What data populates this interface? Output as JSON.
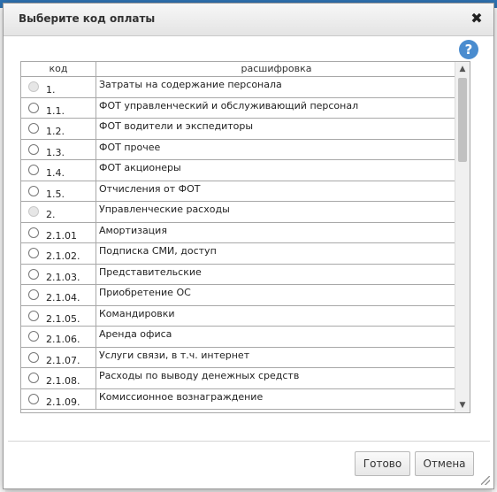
{
  "dialog": {
    "title": "Выберите код оплаты",
    "close_icon": "close-icon",
    "help_icon": "help-icon",
    "help_glyph": "?"
  },
  "table": {
    "columns": [
      "код",
      "расшифровка"
    ],
    "rows": [
      {
        "code": "1.",
        "desc": "Затраты на содержание персонала",
        "selectable": false
      },
      {
        "code": "1.1.",
        "desc": "ФОТ управленческий и обслуживающий персонал",
        "selectable": true
      },
      {
        "code": "1.2.",
        "desc": "ФОТ водители и экспедиторы",
        "selectable": true
      },
      {
        "code": "1.3.",
        "desc": "ФОТ прочее",
        "selectable": true
      },
      {
        "code": "1.4.",
        "desc": "ФОТ акционеры",
        "selectable": true
      },
      {
        "code": "1.5.",
        "desc": "Отчисления от ФОТ",
        "selectable": true
      },
      {
        "code": "2.",
        "desc": "Управленческие расходы",
        "selectable": false
      },
      {
        "code": "2.1.01",
        "desc": "Амортизация",
        "selectable": true
      },
      {
        "code": "2.1.02.",
        "desc": "Подписка СМИ, доступ",
        "selectable": true
      },
      {
        "code": "2.1.03.",
        "desc": "Представительские",
        "selectable": true
      },
      {
        "code": "2.1.04.",
        "desc": "Приобретение ОС",
        "selectable": true
      },
      {
        "code": "2.1.05.",
        "desc": "Командировки",
        "selectable": true
      },
      {
        "code": "2.1.06.",
        "desc": "Аренда офиса",
        "selectable": true
      },
      {
        "code": "2.1.07.",
        "desc": "Услуги связи, в т.ч. интернет",
        "selectable": true
      },
      {
        "code": "2.1.08.",
        "desc": "Расходы по выводу денежных средств",
        "selectable": true
      },
      {
        "code": "2.1.09.",
        "desc": "Комиссионное вознаграждение",
        "selectable": true
      }
    ]
  },
  "footer": {
    "ok_label": "Готово",
    "cancel_label": "Отмена"
  }
}
